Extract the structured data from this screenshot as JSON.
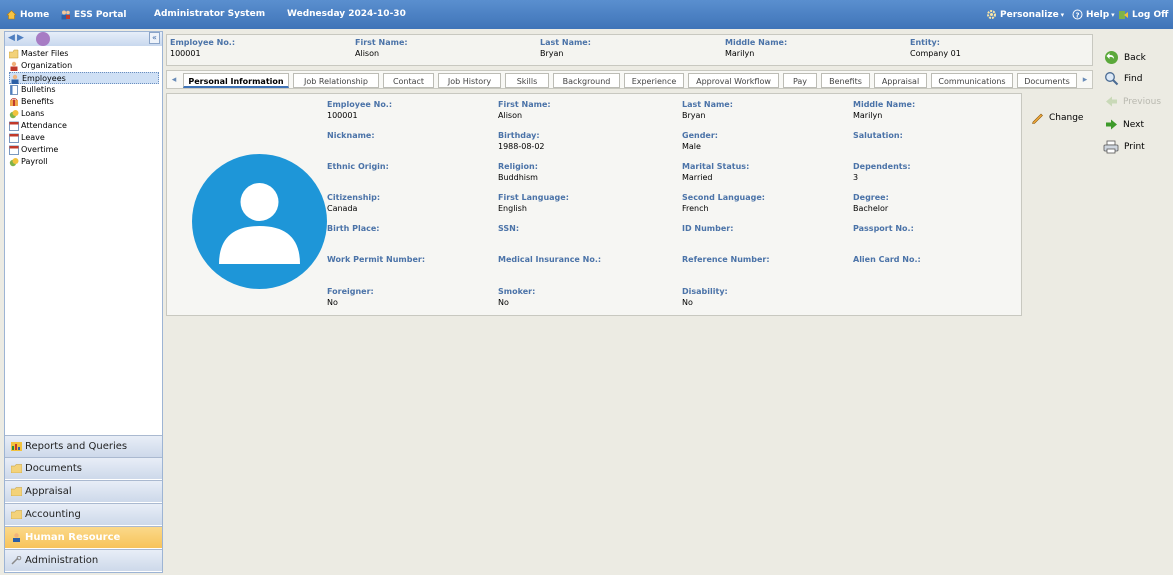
{
  "topbar": {
    "home": "Home",
    "ess": "ESS Portal",
    "system": "Administrator System",
    "date": "Wednesday 2024-10-30",
    "personalize": "Personalize",
    "help": "Help",
    "logoff": "Log Off"
  },
  "tree": {
    "items": [
      {
        "label": "Master Files",
        "icon": "folder-icon"
      },
      {
        "label": "Organization",
        "icon": "person-icon"
      },
      {
        "label": "Employees",
        "icon": "person-icon"
      },
      {
        "label": "Bulletins",
        "icon": "document-icon"
      },
      {
        "label": "Benefits",
        "icon": "gift-icon"
      },
      {
        "label": "Loans",
        "icon": "coins-icon"
      },
      {
        "label": "Attendance",
        "icon": "calendar-icon"
      },
      {
        "label": "Leave",
        "icon": "calendar-icon"
      },
      {
        "label": "Overtime",
        "icon": "calendar-icon"
      },
      {
        "label": "Payroll",
        "icon": "coins-icon"
      }
    ]
  },
  "accordion": {
    "reports": "Reports and Queries",
    "documents": "Documents",
    "appraisal": "Appraisal",
    "accounting": "Accounting",
    "hr": "Human Resource",
    "admin": "Administration"
  },
  "header": {
    "employee_no_label": "Employee No.:",
    "employee_no": "100001",
    "first_name_label": "First Name:",
    "first_name": "Alison",
    "last_name_label": "Last Name:",
    "last_name": "Bryan",
    "middle_name_label": "Middle Name:",
    "middle_name": "Marilyn",
    "entity_label": "Entity:",
    "entity": "Company 01"
  },
  "tabs": {
    "personal": "Personal Information",
    "job_relationship": "Job Relationship",
    "contact": "Contact",
    "job_history": "Job History",
    "skills": "Skills",
    "background": "Background",
    "experience": "Experience",
    "approval": "Approval Workflow",
    "pay": "Pay",
    "benefits": "Benefits",
    "appraisal": "Appraisal",
    "communications": "Communications",
    "documents": "Documents"
  },
  "fields": {
    "employee_no": {
      "label": "Employee No.:",
      "value": "100001"
    },
    "first_name": {
      "label": "First Name:",
      "value": "Alison"
    },
    "last_name": {
      "label": "Last Name:",
      "value": "Bryan"
    },
    "middle_name": {
      "label": "Middle Name:",
      "value": "Marilyn"
    },
    "nickname": {
      "label": "Nickname:",
      "value": ""
    },
    "birthday": {
      "label": "Birthday:",
      "value": "1988-08-02"
    },
    "gender": {
      "label": "Gender:",
      "value": "Male"
    },
    "salutation": {
      "label": "Salutation:",
      "value": ""
    },
    "ethnic": {
      "label": "Ethnic Origin:",
      "value": ""
    },
    "religion": {
      "label": "Religion:",
      "value": "Buddhism"
    },
    "marital": {
      "label": "Marital Status:",
      "value": "Married"
    },
    "dependents": {
      "label": "Dependents:",
      "value": "3"
    },
    "citizenship": {
      "label": "Citizenship:",
      "value": "Canada"
    },
    "first_language": {
      "label": "First Language:",
      "value": "English"
    },
    "second_language": {
      "label": "Second Language:",
      "value": "French"
    },
    "degree": {
      "label": "Degree:",
      "value": "Bachelor"
    },
    "birth_place": {
      "label": "Birth Place:",
      "value": ""
    },
    "ssn": {
      "label": "SSN:",
      "value": ""
    },
    "id_number": {
      "label": "ID Number:",
      "value": ""
    },
    "passport": {
      "label": "Passport No.:",
      "value": ""
    },
    "work_permit": {
      "label": "Work Permit Number:",
      "value": ""
    },
    "medical": {
      "label": "Medical Insurance No.:",
      "value": ""
    },
    "reference": {
      "label": "Reference Number:",
      "value": ""
    },
    "alien": {
      "label": "Alien Card No.:",
      "value": ""
    },
    "foreigner": {
      "label": "Foreigner:",
      "value": "No"
    },
    "smoker": {
      "label": "Smoker:",
      "value": "No"
    },
    "disability": {
      "label": "Disability:",
      "value": "No"
    }
  },
  "actions": {
    "change": "Change",
    "back": "Back",
    "find": "Find",
    "previous": "Previous",
    "next": "Next",
    "print": "Print"
  },
  "colors": {
    "topbar": "#3f74b8",
    "label_blue": "#4b73a8",
    "avatar": "#1e96d8",
    "active_accordion": "#f7c35a"
  }
}
